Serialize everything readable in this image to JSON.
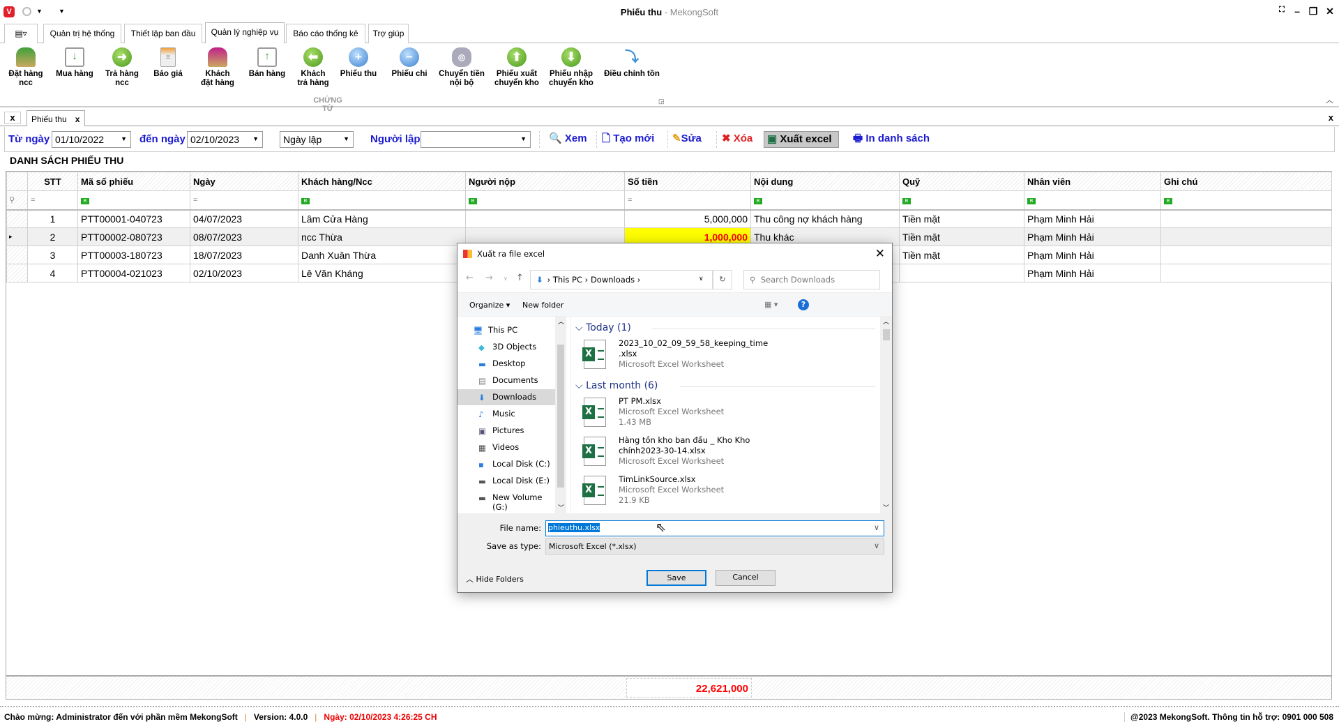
{
  "window": {
    "title": "Phiếu thu",
    "app": "MekongSoft",
    "separator": " - "
  },
  "ribbon_tabs": [
    "Quản trị hệ thống",
    "Thiết lập ban đầu",
    "Quản lý nghiệp vụ",
    "Báo cáo thống kê",
    "Trợ giúp"
  ],
  "ribbon": {
    "group": "CHỨNG TỪ",
    "buttons": [
      {
        "l1": "Đặt hàng",
        "l2": "ncc",
        "icon": "supplier-order-icon"
      },
      {
        "l1": "Mua hàng",
        "l2": "",
        "icon": "purchase-cart-icon"
      },
      {
        "l1": "Trả hàng",
        "l2": "ncc",
        "icon": "arrow-right-icon"
      },
      {
        "l1": "Báo giá",
        "l2": "",
        "icon": "quote-document-icon"
      },
      {
        "l1": "Khách",
        "l2": "đặt hàng",
        "icon": "customer-order-icon"
      },
      {
        "l1": "Bán hàng",
        "l2": "",
        "icon": "sale-cart-icon"
      },
      {
        "l1": "Khách",
        "l2": "trả hàng",
        "icon": "arrow-left-icon"
      },
      {
        "l1": "Phiếu thu",
        "l2": "",
        "icon": "plus-circle-icon"
      },
      {
        "l1": "Phiếu chi",
        "l2": "",
        "icon": "minus-circle-icon"
      },
      {
        "l1": "Chuyển tiền",
        "l2": "nội bộ",
        "icon": "coins-icon"
      },
      {
        "l1": "Phiếu xuất",
        "l2": "chuyển kho",
        "icon": "arrow-up-icon"
      },
      {
        "l1": "Phiếu nhập",
        "l2": "chuyển kho",
        "icon": "arrow-down-icon"
      },
      {
        "l1": "Điều chỉnh tồn",
        "l2": "",
        "icon": "adjust-chart-icon"
      }
    ]
  },
  "doc_tab": "Phiếu thu",
  "filter": {
    "from_label": "Từ ngày",
    "from": "01/10/2022",
    "to_label": "đến ngày",
    "to": "02/10/2023",
    "date_type": "Ngày lập",
    "creator_label": "Người lập",
    "creator": "",
    "view": "Xem",
    "create": "Tạo mới",
    "edit": "Sửa",
    "delete": "Xóa",
    "export": "Xuất excel",
    "print": "In danh sách"
  },
  "list_title": "DANH SÁCH PHIẾU THU",
  "columns": [
    "STT",
    "Mã số phiếu",
    "Ngày",
    "Khách hàng/Ncc",
    "Người nộp",
    "Số tiền",
    "Nội dung",
    "Quỹ",
    "Nhân viên",
    "Ghi chú"
  ],
  "rows": [
    [
      "1",
      "PTT00001-040723",
      "04/07/2023",
      "Lâm Cửa Hàng",
      "",
      "5,000,000",
      "Thu công nợ khách hàng",
      "Tiền mặt",
      "Phạm Minh Hải",
      ""
    ],
    [
      "2",
      "PTT00002-080723",
      "08/07/2023",
      "ncc Thừa",
      "",
      "1,000,000",
      "Thu khác",
      "Tiền mặt",
      "Phạm Minh Hải",
      ""
    ],
    [
      "3",
      "PTT00003-180723",
      "18/07/2023",
      "Danh Xuân Thừa",
      "",
      "",
      "",
      "Tiền mặt",
      "Phạm Minh Hải",
      ""
    ],
    [
      "4",
      "PTT00004-021023",
      "02/10/2023",
      "Lê Văn Kháng",
      "",
      "",
      "",
      "",
      "Phạm Minh Hải",
      ""
    ]
  ],
  "total": "22,621,000",
  "status": {
    "welcome": "Chào mừng: Administrator đến với phần mềm MekongSoft",
    "version": "Version: 4.0.0",
    "date": "Ngày: 02/10/2023 4:26:25 CH",
    "copyright": "@2023 MekongSoft. Thông tin hỗ trợ: 0901 000 508"
  },
  "dialog": {
    "title": "Xuất ra file excel",
    "path": [
      "This PC",
      "Downloads"
    ],
    "search_placeholder": "Search Downloads",
    "organize": "Organize ▾",
    "new_folder": "New folder",
    "nav": [
      "This PC",
      "3D Objects",
      "Desktop",
      "Documents",
      "Downloads",
      "Music",
      "Pictures",
      "Videos",
      "Local Disk (C:)",
      "Local Disk (E:)",
      "New Volume (G:)"
    ],
    "groups": [
      {
        "label": "Today (1)"
      },
      {
        "label": "Last month (6)"
      }
    ],
    "files": [
      {
        "name": "2023_10_02_09_59_58_keeping_time",
        "name2": ".xlsx",
        "type": "Microsoft Excel Worksheet",
        "size": ""
      },
      {
        "name": "PT PM.xlsx",
        "name2": "",
        "type": "Microsoft Excel Worksheet",
        "size": "1.43 MB"
      },
      {
        "name": "Hàng tồn kho ban đầu _ Kho Kho",
        "name2": "chính2023-30-14.xlsx",
        "type": "Microsoft Excel Worksheet",
        "size": ""
      },
      {
        "name": "TimLinkSource.xlsx",
        "name2": "",
        "type": "Microsoft Excel Worksheet",
        "size": "21.9 KB"
      }
    ],
    "file_name_label": "File name:",
    "file_name": "phieuthu.xlsx",
    "type_label": "Save as type:",
    "type": "Microsoft Excel  (*.xlsx)",
    "save": "Save",
    "cancel": "Cancel",
    "hide_folders": "Hide Folders"
  }
}
